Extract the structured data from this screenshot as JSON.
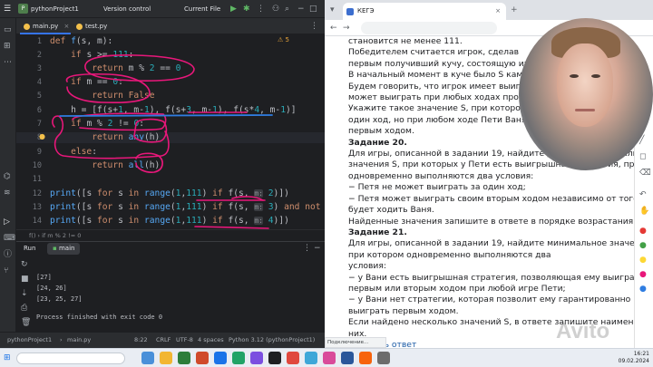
{
  "ide": {
    "project": "pythonProject1",
    "vcs": "Version control",
    "run_config": "Current File",
    "tabs": [
      "main.py",
      "test.py"
    ],
    "warning_count": "5",
    "line_numbers": [
      "1",
      "2",
      "3",
      "4",
      "5",
      "6",
      "7",
      "8",
      "9",
      "10",
      "11",
      "12",
      "13",
      "14",
      "15",
      "16"
    ],
    "breadcrumb": "f()  ›  if m % 2 != 0",
    "run_title": "Run",
    "run_config_name": "main",
    "output": [
      "[27]",
      "[24, 26]",
      "[23, 25, 27]",
      "",
      "Process finished with exit code 0"
    ],
    "status": {
      "path1": "pythonProject1",
      "path2": "main.py",
      "pos": "8:22",
      "le": "CRLF",
      "enc": "UTF-8",
      "indent": "4 spaces",
      "interp": "Python 3.12 (pythonProject1)"
    },
    "hints": {
      "m2": "m:",
      "v2": "2",
      "m3": "m:",
      "v3": "3",
      "m4": "m:",
      "v4": "4"
    }
  },
  "browser": {
    "tab_title": "КЕГЭ",
    "doc_lines": [
      {
        "t": "становится не менее 111.",
        "b": false
      },
      {
        "t": "Победителем   считается   игрок,   сделав",
        "b": false
      },
      {
        "t": "первым получивший кучу, состоящую из",
        "b": false
      },
      {
        "t": "В начальный момент в куче было S камн",
        "b": false
      },
      {
        "t": "Будем говорить, что игрок имеет выигр",
        "b": false
      },
      {
        "t": "может выиграть при любых ходах против",
        "b": false
      },
      {
        "t": "Укажите такое значение S, при котором П",
        "b": false
      },
      {
        "t": "один ход, но при любом ходе Пети Ваня",
        "b": false
      },
      {
        "t": "первым ходом.",
        "b": false
      },
      {
        "t": "Задание 20.",
        "b": true
      },
      {
        "t": "Для игры, описанной в задании 19, найдите два таких минимальных",
        "b": false
      },
      {
        "t": "значения S, при которых у Пети есть выигрышная стратегия, причём",
        "b": false
      },
      {
        "t": "одновременно выполняются два условия:",
        "b": false
      },
      {
        "t": "− Петя не может выиграть за один ход;",
        "b": false
      },
      {
        "t": "− Петя может выиграть своим вторым ходом независимо от того, как",
        "b": false
      },
      {
        "t": "будет ходить Ваня.",
        "b": false
      },
      {
        "t": "Найденные значения запишите в ответе в порядке возрастания.",
        "b": false
      },
      {
        "t": "Задание 21.",
        "b": true
      },
      {
        "t": "Для игры, описанной в задании 19, найдите минимальное значение S,",
        "b": false
      },
      {
        "t": "при котором одновременно выполняются два",
        "b": false
      },
      {
        "t": "условия:",
        "b": false
      },
      {
        "t": "− у Вани есть выигрышная стратегия, позволяющая ему выиграть",
        "b": false
      },
      {
        "t": "первым или вторым ходом при любой игре Пети;",
        "b": false
      },
      {
        "t": "− у Вани нет стратегии, которая позволит ему гарантированно",
        "b": false
      },
      {
        "t": "выиграть первым ходом.",
        "b": false
      },
      {
        "t": "Если найдено несколько значений S, в ответе запишите наименьшее из",
        "b": false
      },
      {
        "t": "них.",
        "b": false
      }
    ],
    "show_answer": "Показать ответ",
    "status_text": "Подключение...",
    "watermark": "Avito"
  },
  "taskbar": {
    "time": "16:21",
    "date": "09.02.2024"
  },
  "colors": {
    "annotation": "#e8177a",
    "underline": "#2f7de1",
    "accent": "#3574f0"
  }
}
